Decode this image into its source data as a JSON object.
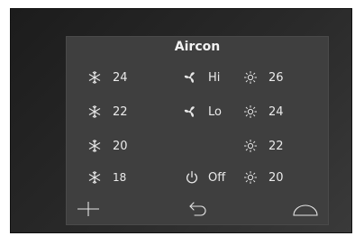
{
  "screen": {
    "title": "Aircon"
  },
  "cooling": {
    "icon": "snowflake-icon",
    "values": [
      "24",
      "22",
      "20",
      "18"
    ]
  },
  "fan": {
    "icon": "fan-icon",
    "hi": "Hi",
    "lo": "Lo"
  },
  "power": {
    "icon": "power-icon",
    "label": "Off"
  },
  "heating": {
    "icon": "sun-icon",
    "values": [
      "26",
      "24",
      "22",
      "20"
    ]
  },
  "bottom_bar": {
    "left_icon": "plus-icon",
    "center_icon": "back-arrow-icon",
    "right_icon": "dome-icon"
  }
}
